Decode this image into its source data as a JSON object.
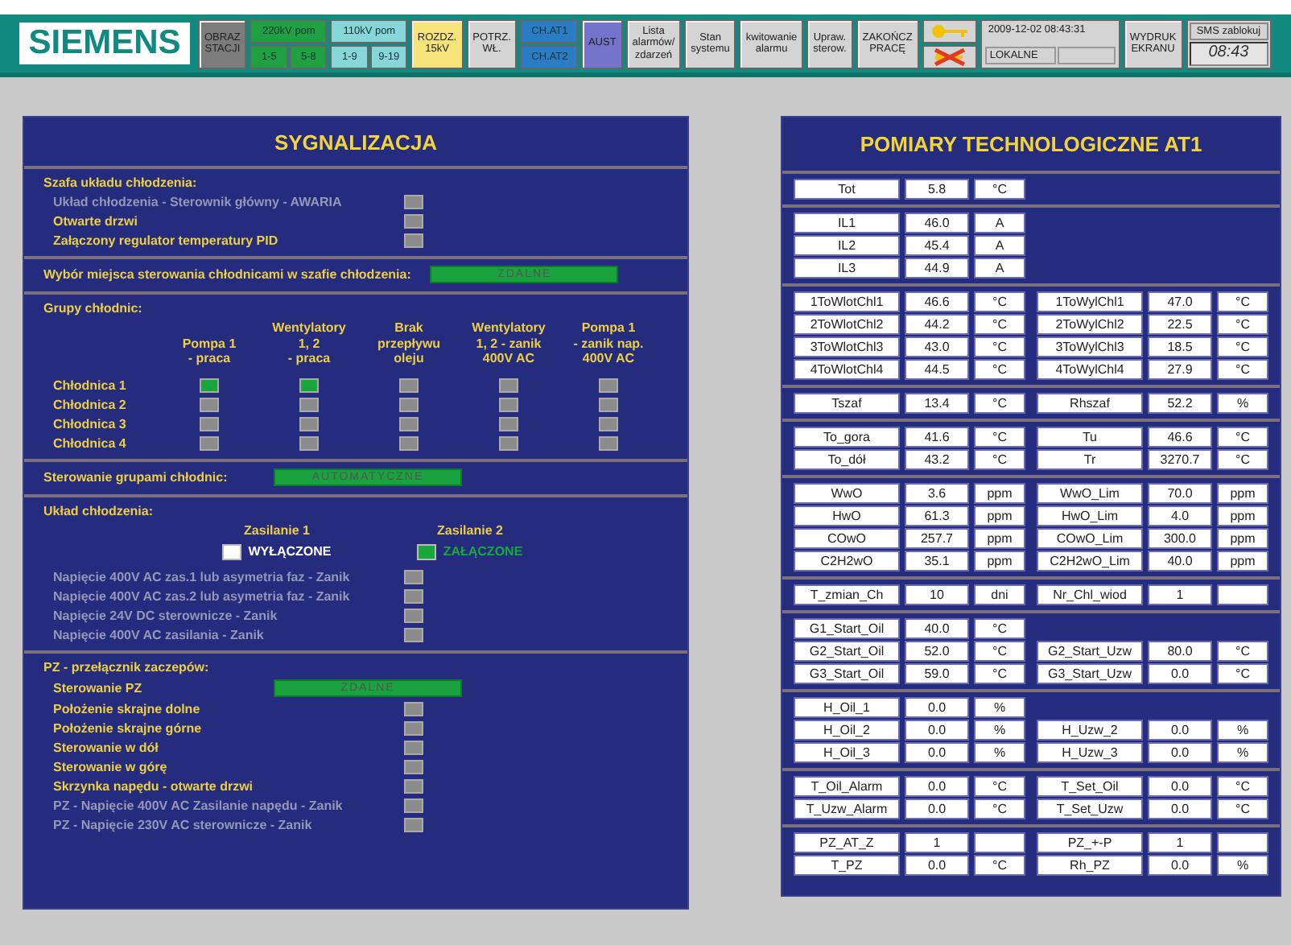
{
  "toolbar": {
    "logo": "SIEMENS",
    "items": [
      {
        "kind": "button",
        "label": "OBRAZ\nSTACJI",
        "color": "#7c7c7c"
      },
      {
        "kind": "group",
        "label": "220kV pom",
        "color": "#1fa043",
        "subs": [
          "1-5",
          "5-8"
        ]
      },
      {
        "kind": "group",
        "label": "110kV pom",
        "color": "#86d6da",
        "subs": [
          "1-9",
          "9-19"
        ]
      },
      {
        "kind": "button",
        "label": "ROZDZ.\n15kV",
        "color": "#f6e47a"
      },
      {
        "kind": "button",
        "label": "POTRZ.\nWŁ.",
        "color": "#d4d4d4"
      },
      {
        "kind": "pair",
        "color": "#2a7cc4",
        "subs": [
          "CH.AT1",
          "CH.AT2"
        ]
      },
      {
        "kind": "button",
        "label": "AUST",
        "color": "#7474cc"
      },
      {
        "kind": "button",
        "label": "Lista\nalarmów/\nzdarzeń",
        "color": "#d4d4d4"
      },
      {
        "kind": "button",
        "label": "Stan\nsystemu",
        "color": "#d4d4d4"
      },
      {
        "kind": "button",
        "label": "kwitowanie\nalarmu",
        "color": "#d4d4d4"
      },
      {
        "kind": "button",
        "label": "Upraw.\nsterow.",
        "color": "#d4d4d4"
      },
      {
        "kind": "button",
        "label": "ZAKOŃCZ\nPRACĘ",
        "color": "#d4d4d4"
      },
      {
        "kind": "keys"
      },
      {
        "kind": "clock",
        "datetime": "2009-12-02 08:43:31",
        "mode": "LOKALNE"
      },
      {
        "kind": "button",
        "label": "WYDRUK\nEKRANU",
        "color": "#d4d4d4"
      },
      {
        "kind": "sms",
        "label": "SMS zablokuj",
        "time": "08:43"
      }
    ]
  },
  "left": {
    "title": "SYGNALIZACJA",
    "sections": [
      {
        "kind": "signals",
        "title": "Szafa układu chłodzenia:",
        "items": [
          {
            "kind": "signal",
            "label": "Układ chłodzenia - Sterownik główny - AWARIA",
            "disabled": true,
            "on": false
          },
          {
            "kind": "signal",
            "label": "Otwarte drzwi",
            "disabled": false,
            "on": false
          },
          {
            "kind": "signal",
            "label": "Załączony regulator temperatury PID",
            "disabled": false,
            "on": false
          }
        ]
      },
      {
        "kind": "status",
        "title": "Wybór miejsca sterowania chłodnicami w szafie chłodzenia:",
        "value": "ZDALNE"
      },
      {
        "kind": "grid",
        "title": "Grupy chłodnic:",
        "columns": [
          "Pompa 1\n- praca",
          "Wentylatory\n1, 2\n- praca",
          "Brak\nprzepływu\noleju",
          "Wentylatory\n1, 2 - zanik\n400V AC",
          "Pompa 1\n- zanik nap.\n400V AC"
        ],
        "rows": [
          {
            "label": "Chłodnica 1",
            "on": [
              true,
              true,
              false,
              false,
              false
            ]
          },
          {
            "label": "Chłodnica 2",
            "on": [
              false,
              false,
              false,
              false,
              false
            ]
          },
          {
            "label": "Chłodnica 3",
            "on": [
              false,
              false,
              false,
              false,
              false
            ]
          },
          {
            "label": "Chłodnica 4",
            "on": [
              false,
              false,
              false,
              false,
              false
            ]
          }
        ]
      },
      {
        "kind": "status",
        "title": "Sterowanie grupami chłodnic:",
        "value": "AUTOMATYCZNE"
      },
      {
        "kind": "supply",
        "title": "Układ chłodzenia:",
        "supplies": [
          {
            "label": "Zasilanie 1",
            "state": "WYŁĄCZONE",
            "on": false
          },
          {
            "label": "Zasilanie 2",
            "state": "ZAŁĄCZONE",
            "on": true
          }
        ],
        "items": [
          {
            "kind": "signal",
            "label": "Napięcie 400V AC zas.1 lub asymetria faz - Zanik",
            "disabled": true,
            "on": false
          },
          {
            "kind": "signal",
            "label": "Napięcie 400V AC zas.2 lub asymetria faz - Zanik",
            "disabled": true,
            "on": false
          },
          {
            "kind": "signal",
            "label": "Napięcie 24V DC sterownicze - Zanik",
            "disabled": true,
            "on": false
          },
          {
            "kind": "signal",
            "label": "Napięcie 400V AC zasilania - Zanik",
            "disabled": true,
            "on": false
          }
        ]
      },
      {
        "kind": "signals",
        "title": "PZ - przełącznik zaczepów:",
        "items": [
          {
            "kind": "status",
            "label": "Sterowanie PZ",
            "value": "ZDALNE"
          },
          {
            "kind": "signal",
            "label": "Położenie skrajne dolne",
            "disabled": false,
            "on": false
          },
          {
            "kind": "signal",
            "label": "Położenie skrajne górne",
            "disabled": false,
            "on": false
          },
          {
            "kind": "signal",
            "label": "Sterowanie w dół",
            "disabled": false,
            "on": false
          },
          {
            "kind": "signal",
            "label": "Sterowanie w górę",
            "disabled": false,
            "on": false
          },
          {
            "kind": "signal",
            "label": "Skrzynka napędu - otwarte drzwi",
            "disabled": false,
            "on": false
          },
          {
            "kind": "signal",
            "label": "PZ - Napięcie 400V AC Zasilanie napędu - Zanik",
            "disabled": true,
            "on": false
          },
          {
            "kind": "signal",
            "label": "PZ - Napięcie 230V AC sterownicze - Zanik",
            "disabled": true,
            "on": false
          }
        ]
      }
    ]
  },
  "right": {
    "title": "POMIARY TECHNOLOGICZNE AT1",
    "groups": [
      [
        [
          {
            "name": "Tot",
            "value": "5.8",
            "unit": "°C"
          }
        ]
      ],
      [
        [
          {
            "name": "IL1",
            "value": "46.0",
            "unit": "A"
          }
        ],
        [
          {
            "name": "IL2",
            "value": "45.4",
            "unit": "A"
          }
        ],
        [
          {
            "name": "IL3",
            "value": "44.9",
            "unit": "A"
          }
        ]
      ],
      [
        [
          {
            "name": "1ToWlotChl1",
            "value": "46.6",
            "unit": "°C"
          },
          {
            "name": "1ToWylChl1",
            "value": "47.0",
            "unit": "°C"
          }
        ],
        [
          {
            "name": "2ToWlotChl2",
            "value": "44.2",
            "unit": "°C"
          },
          {
            "name": "2ToWylChl2",
            "value": "22.5",
            "unit": "°C"
          }
        ],
        [
          {
            "name": "3ToWlotChl3",
            "value": "43.0",
            "unit": "°C"
          },
          {
            "name": "3ToWylChl3",
            "value": "18.5",
            "unit": "°C"
          }
        ],
        [
          {
            "name": "4ToWlotChl4",
            "value": "44.5",
            "unit": "°C"
          },
          {
            "name": "4ToWylChl4",
            "value": "27.9",
            "unit": "°C"
          }
        ]
      ],
      [
        [
          {
            "name": "Tszaf",
            "value": "13.4",
            "unit": "°C"
          },
          {
            "name": "Rhszaf",
            "value": "52.2",
            "unit": "%"
          }
        ]
      ],
      [
        [
          {
            "name": "To_gora",
            "value": "41.6",
            "unit": "°C"
          },
          {
            "name": "Tu",
            "value": "46.6",
            "unit": "°C"
          }
        ],
        [
          {
            "name": "To_dół",
            "value": "43.2",
            "unit": "°C"
          },
          {
            "name": "Tr",
            "value": "3270.7",
            "unit": "°C"
          }
        ]
      ],
      [
        [
          {
            "name": "WwO",
            "value": "3.6",
            "unit": "ppm"
          },
          {
            "name": "WwO_Lim",
            "value": "70.0",
            "unit": "ppm"
          }
        ],
        [
          {
            "name": "HwO",
            "value": "61.3",
            "unit": "ppm"
          },
          {
            "name": "HwO_Lim",
            "value": "4.0",
            "unit": "ppm"
          }
        ],
        [
          {
            "name": "COwO",
            "value": "257.7",
            "unit": "ppm"
          },
          {
            "name": "COwO_Lim",
            "value": "300.0",
            "unit": "ppm"
          }
        ],
        [
          {
            "name": "C2H2wO",
            "value": "35.1",
            "unit": "ppm"
          },
          {
            "name": "C2H2wO_Lim",
            "value": "40.0",
            "unit": "ppm"
          }
        ]
      ],
      [
        [
          {
            "name": "T_zmian_Ch",
            "value": "10",
            "unit": "dni"
          },
          {
            "name": "Nr_Chl_wiod",
            "value": "1"
          }
        ]
      ],
      [
        [
          {
            "name": "G1_Start_Oil",
            "value": "40.0",
            "unit": "°C"
          }
        ],
        [
          {
            "name": "G2_Start_Oil",
            "value": "52.0",
            "unit": "°C"
          },
          {
            "name": "G2_Start_Uzw",
            "value": "80.0",
            "unit": "°C"
          }
        ],
        [
          {
            "name": "G3_Start_Oil",
            "value": "59.0",
            "unit": "°C"
          },
          {
            "name": "G3_Start_Uzw",
            "value": "0.0",
            "unit": "°C"
          }
        ]
      ],
      [
        [
          {
            "name": "H_Oil_1",
            "value": "0.0",
            "unit": "%"
          }
        ],
        [
          {
            "name": "H_Oil_2",
            "value": "0.0",
            "unit": "%"
          },
          {
            "name": "H_Uzw_2",
            "value": "0.0",
            "unit": "%"
          }
        ],
        [
          {
            "name": "H_Oil_3",
            "value": "0.0",
            "unit": "%"
          },
          {
            "name": "H_Uzw_3",
            "value": "0.0",
            "unit": "%"
          }
        ]
      ],
      [
        [
          {
            "name": "T_Oil_Alarm",
            "value": "0.0",
            "unit": "°C"
          },
          {
            "name": "T_Set_Oil",
            "value": "0.0",
            "unit": "°C"
          }
        ],
        [
          {
            "name": "T_Uzw_Alarm",
            "value": "0.0",
            "unit": "°C"
          },
          {
            "name": "T_Set_Uzw",
            "value": "0.0",
            "unit": "°C"
          }
        ]
      ],
      [
        [
          {
            "name": "PZ_AT_Z",
            "value": "1"
          },
          {
            "name": "PZ_+-P",
            "value": "1"
          }
        ],
        [
          {
            "name": "T_PZ",
            "value": "0.0",
            "unit": "°C"
          },
          {
            "name": "Rh_PZ",
            "value": "0.0",
            "unit": "%"
          }
        ]
      ]
    ]
  }
}
